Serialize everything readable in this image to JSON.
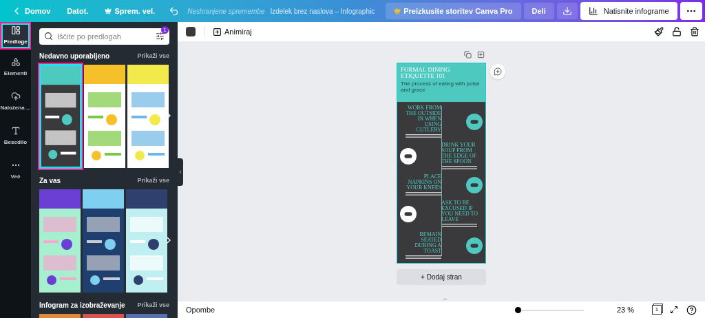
{
  "topbar": {
    "back": "Domov",
    "file": "Datot.",
    "resize": "Sprem. vel.",
    "status": "Neshranjene spremembe",
    "title": "Izdelek brez naslova – Infographic",
    "pro": "Preizkusite storitev Canva Pro",
    "share": "Deli",
    "print": "Natisnite infograme"
  },
  "rail": [
    {
      "label": "Predloge",
      "selected": true
    },
    {
      "label": "Elementi",
      "selected": false
    },
    {
      "label": "Naložena ...",
      "selected": false
    },
    {
      "label": "Besedilo",
      "selected": false
    },
    {
      "label": "Več",
      "selected": false
    }
  ],
  "search": {
    "placeholder": "Iščite po predlogah",
    "filter_badge": "1"
  },
  "sections": [
    {
      "title": "Nedavno uporabljeno",
      "link": "Prikaži vse",
      "thumbnails": [
        {
          "kind": "picture",
          "selected": true
        },
        {
          "kind": "picture",
          "selected": false
        },
        {
          "kind": "picture",
          "selected": false
        }
      ]
    },
    {
      "title": "Za vas",
      "link": "Prikaži vse",
      "thumbnails": [
        {
          "kind": "picture",
          "selected": false
        },
        {
          "kind": "picture",
          "selected": false
        },
        {
          "kind": "picture",
          "selected": false
        }
      ]
    },
    {
      "title": "Infogram za izobraževanje",
      "link": "Prikaži vse",
      "thumbnails": [
        {
          "kind": "picture",
          "selected": false
        },
        {
          "kind": "picture",
          "selected": false
        },
        {
          "kind": "picture",
          "selected": false
        }
      ]
    }
  ],
  "toolbar": {
    "animate": "Animiraj"
  },
  "page": {
    "title": "FORMAL DINING ETIQUETTE 101",
    "subtitle": "The process of eating with poise and grace",
    "steps": [
      {
        "heading": "WORK FROM THE OUTSIDE IN WHEN USING CUTLERY"
      },
      {
        "heading": "DRINK YOUR SOUP FROM THE EDGE OF THE SPOON"
      },
      {
        "heading": "PLACE NAPKINS ON YOUR KNEES"
      },
      {
        "heading": "ASK TO BE EXCUSED IF YOU NEED TO LEAVE"
      },
      {
        "heading": "REMAIN SEATED DURING A TOAST"
      }
    ]
  },
  "add_page": "+ Dodaj stran",
  "bottombar": {
    "notes": "Opombe",
    "zoom": {
      "level": 0.0
    },
    "zoom_reading": "23 %",
    "page_count": "1"
  }
}
